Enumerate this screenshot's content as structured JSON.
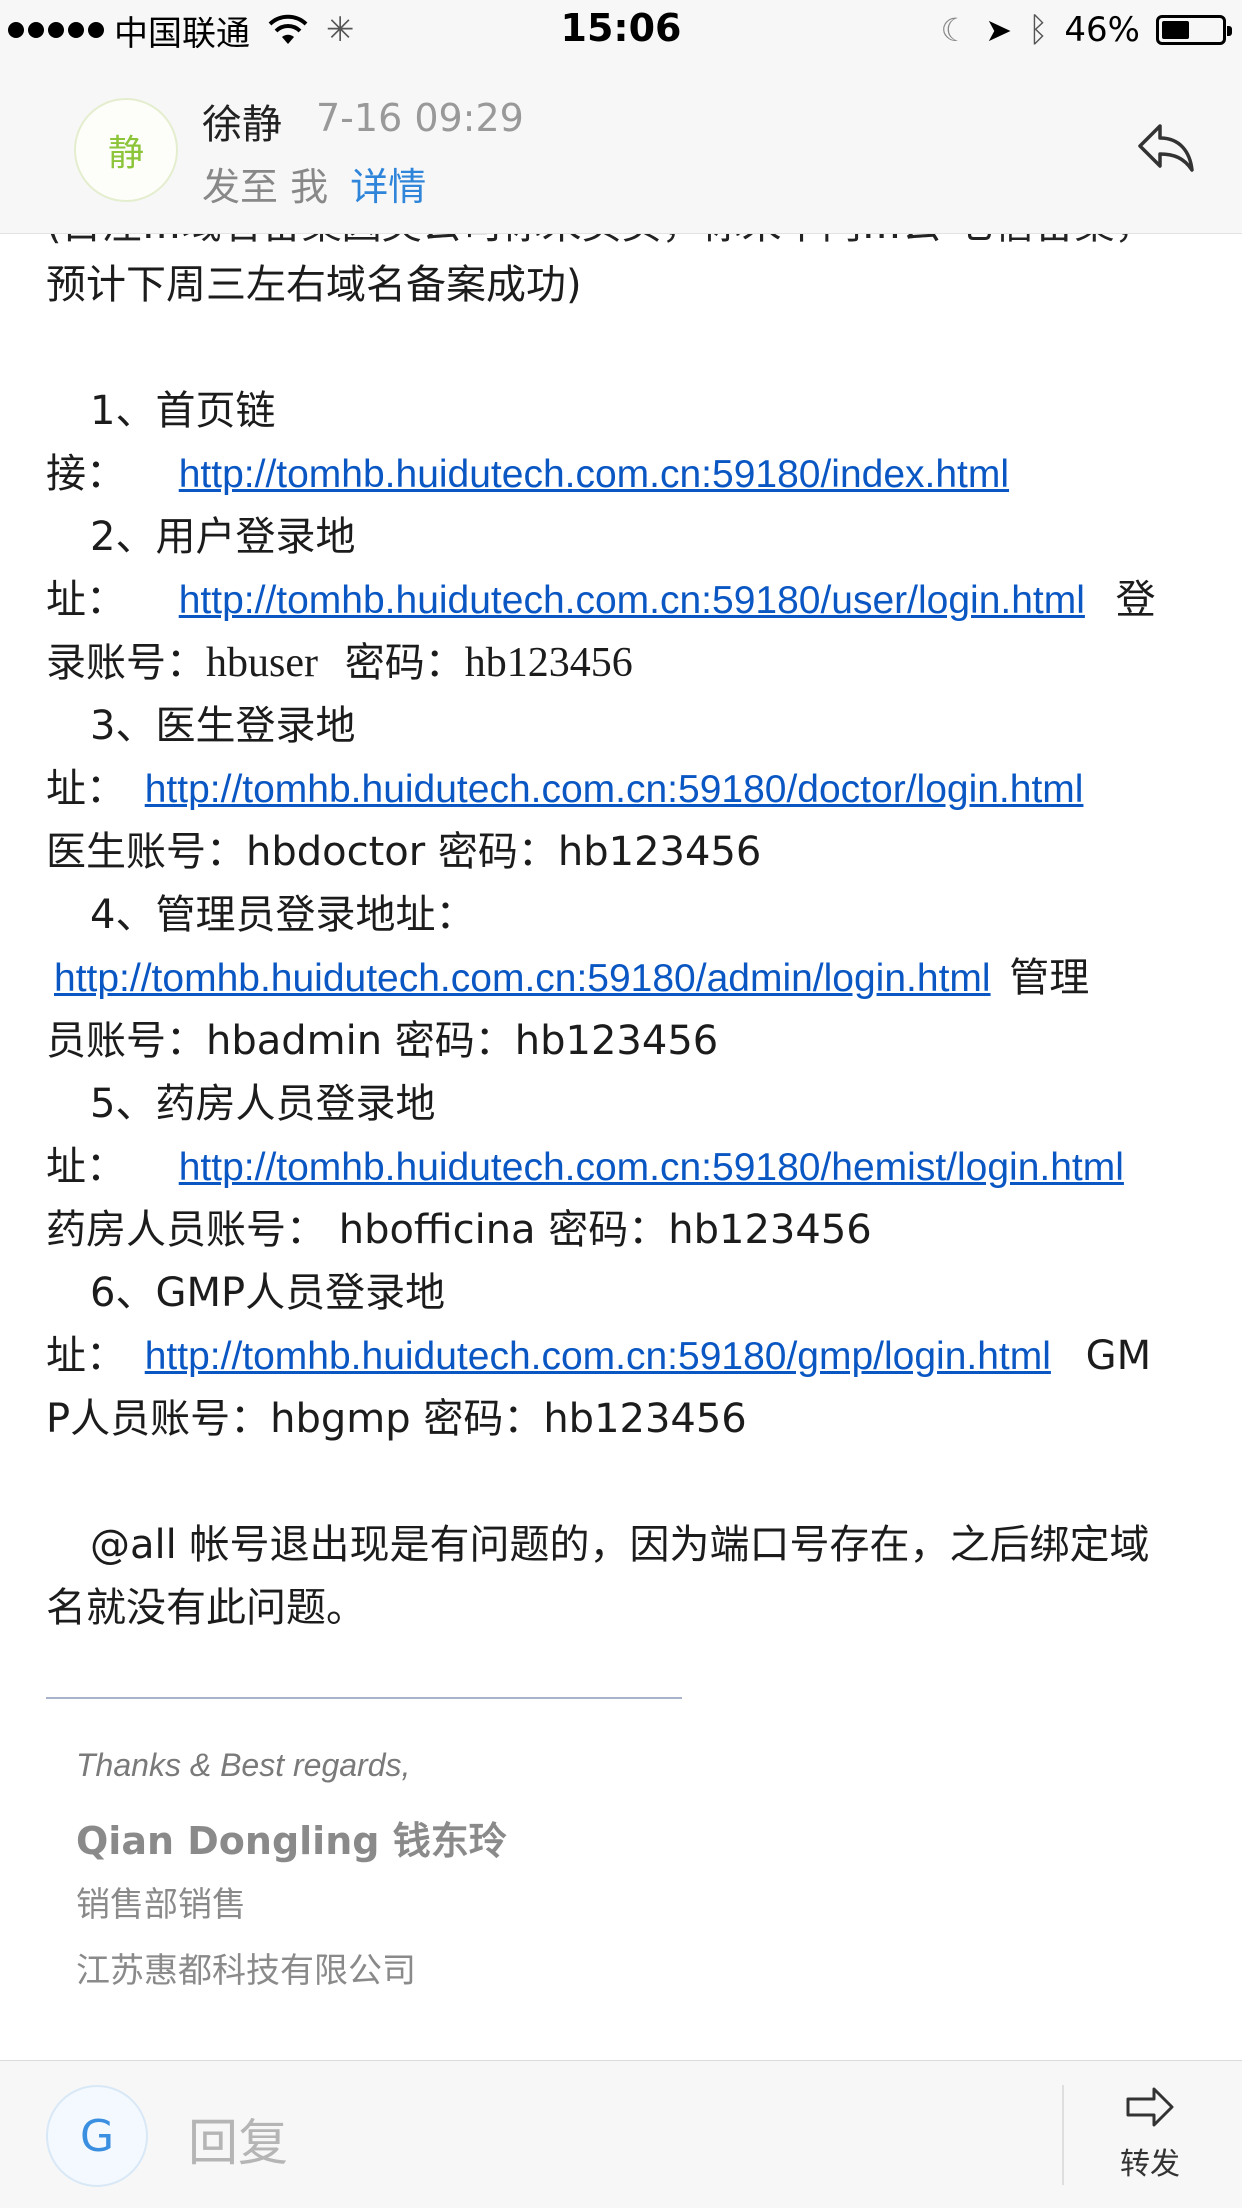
{
  "status_bar": {
    "carrier": "中国联通",
    "time": "15:06",
    "battery_percent": "46%",
    "battery_level": 0.46
  },
  "header": {
    "avatar_letter": "静",
    "sender": "徐静",
    "date": "7-16 09:29",
    "to_label": "发至 我",
    "details": "详情"
  },
  "body": {
    "cut_line": "(目注…域名备案因英公司你未页页，你未平门…公·七信备案，",
    "lines": [
      "预计下周三左右域名备案成功)"
    ],
    "items": [
      {
        "title": "1、首页链",
        "prefix": "接：",
        "url": "http://tomhb.huidutech.com.cn:59180/index.html"
      },
      {
        "title": "2、用户登录地",
        "prefix": "址：",
        "url": "http://tomhb.huidutech.com.cn:59180/user/login.html",
        "suffix": "登",
        "cont_label": "录账号：",
        "account": "hbuser",
        "pwd_label": "密码：",
        "pwd": "hb123456"
      },
      {
        "title": "3、医生登录地",
        "prefix": "址：",
        "url": "http://tomhb.huidutech.com.cn:59180/doctor/login.html",
        "cont": "医生账号：hbdoctor 密码：hb123456"
      },
      {
        "title": "4、管理员登录地址：",
        "url": "http://tomhb.huidutech.com.cn:59180/admin/login.html",
        "suffix": "管理",
        "cont": "员账号：hbadmin 密码：hb123456"
      },
      {
        "title": "5、药房人员登录地",
        "prefix": "址：",
        "url": "http://tomhb.huidutech.com.cn:59180/hemist/login.html",
        "cont": "药房人员账号： hbofficina  密码：hb123456"
      },
      {
        "title": "6、GMP人员登录地",
        "prefix": "址：",
        "url": "http://tomhb.huidutech.com.cn:59180/gmp/login.html",
        "suffix": "GM",
        "cont": "P人员账号：hbgmp  密码：hb123456"
      }
    ],
    "note_line1": "@all 帐号退出现是有问题的，因为端口号存在，之后绑定域",
    "note_line2": "名就没有此问题。"
  },
  "signature": {
    "thanks": "Thanks & Best regards,",
    "name": "Qian Dongling  钱东玲",
    "title": "销售部销售",
    "company": "江苏惠都科技有限公司"
  },
  "footer": {
    "avatar_letter": "G",
    "reply_placeholder": "回复",
    "forward_label": "转发"
  },
  "colors": {
    "link": "#0a57c4",
    "accent": "#2f85d9",
    "avatar_green": "#8cc43a"
  }
}
